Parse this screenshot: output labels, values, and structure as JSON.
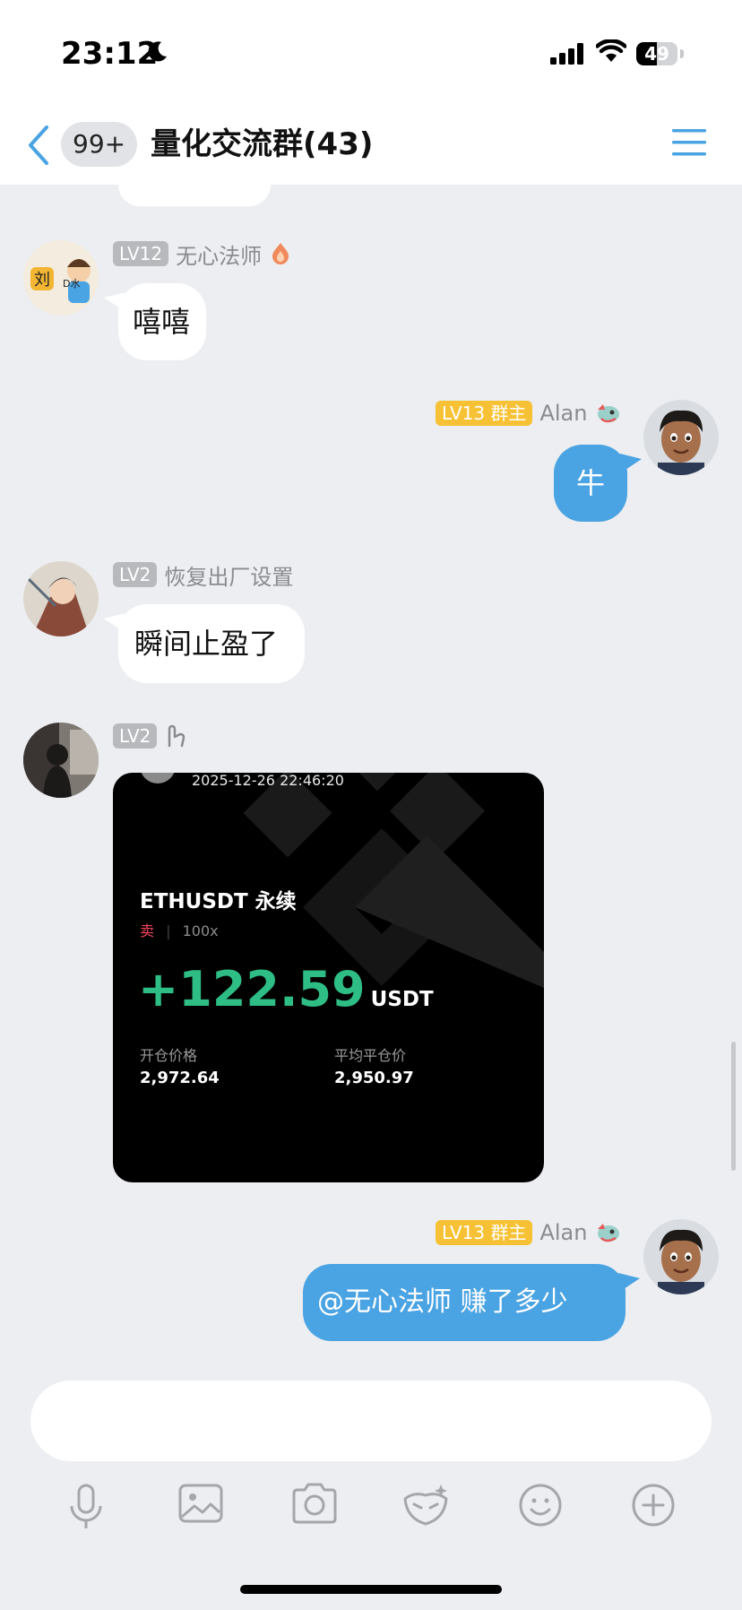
{
  "status_bar": {
    "time": "23:12",
    "battery": "49",
    "battery_level": 0.49
  },
  "header": {
    "unread_count": "99+",
    "title": "量化交流群(43)"
  },
  "messages": [
    {
      "level": "LV12",
      "nickname": "无心法师",
      "text": "嘻嘻"
    },
    {
      "level": "LV13",
      "role": "群主",
      "nickname": "Alan",
      "text": "牛"
    },
    {
      "level": "LV2",
      "nickname": "恢复出厂设置",
      "text": "瞬间止盈了"
    },
    {
      "level": "LV2",
      "card": {
        "timestamp": "2025-12-26 22:46:20",
        "pair": "ETHUSDT 永续",
        "side": "卖",
        "leverage": "100x",
        "pnl": "+122.59",
        "pnl_unit": "USDT",
        "open_price_label": "开仓价格",
        "open_price": "2,972.64",
        "close_price_label": "平均平仓价",
        "close_price": "2,950.97"
      }
    },
    {
      "level": "LV13",
      "role": "群主",
      "nickname": "Alan",
      "text": "@无心法师 赚了多少"
    }
  ],
  "colors": {
    "accent": "#4aa3e2",
    "pnl_green": "#2ebd85",
    "owner_badge": "#f6c134",
    "sell_red": "#f6465d"
  }
}
